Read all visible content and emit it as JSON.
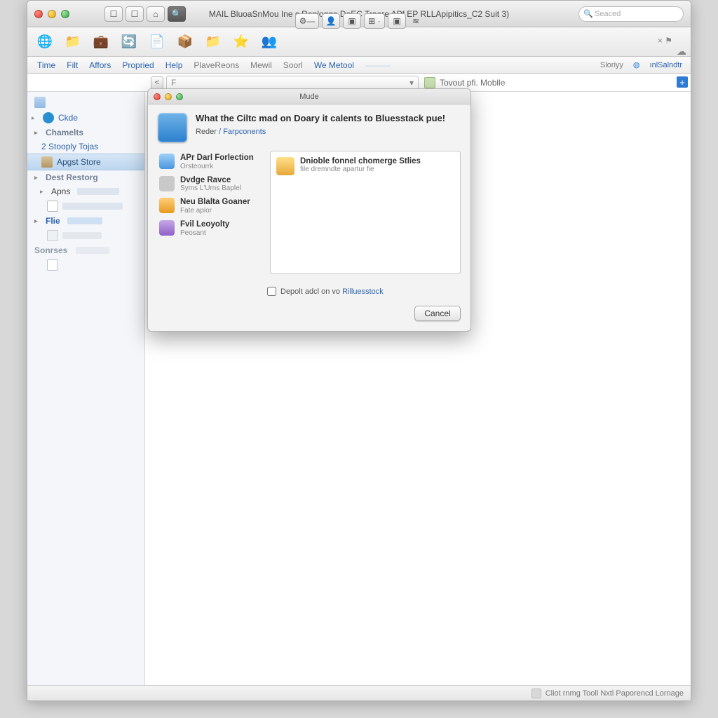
{
  "window": {
    "title": "MAIL BluoaSnMou Ine c Replogge DeEC Traore APf EP RLLApipitics_C2 Suit 3)",
    "search_placeholder": "Seaced"
  },
  "toolbar_center_icons": [
    "⚙—",
    "👤",
    "▣",
    "⊞ ·",
    "▣",
    "≋"
  ],
  "main_toolbar_icons": [
    "globe",
    "folder",
    "briefcase",
    "sync",
    "page",
    "package",
    "folder2",
    "star",
    "people"
  ],
  "menu": {
    "items": [
      "Time",
      "Filt",
      "Affors",
      "Propried",
      "Help",
      "PlaveReons",
      "Mewil",
      "Soorl",
      "We Metool"
    ],
    "extra": "———",
    "right_label_1": "Sloriyy",
    "right_label_2": "ınlSalndtr"
  },
  "pathbar": {
    "back_symbol": "<",
    "input_value": "F",
    "right_text": "Tovout pfi. Moblle"
  },
  "sidebar": {
    "top_icon_row": "",
    "code_btn": "Ckde",
    "channels_head": "Chamelts",
    "stoopy": "2 Stooply Tojas",
    "selected": "Apgst Store",
    "dest_head": "Dest Restorg",
    "apps_item": "Apns",
    "apps_sub_smear": "–––––",
    "file_head": "Flie",
    "file_smear": "–––",
    "file_box_smear": "–––––",
    "sources_head": "Sonrses",
    "sources_smear": "–––––"
  },
  "dialog": {
    "title": "Mude",
    "headline": "What the Ciltc mad on Doary it calents to Bluesstack pue!",
    "sub_prefix": "Reder ",
    "sub_link": "/ Farpconents",
    "left_apps": [
      {
        "title": "APr Darl Forlection",
        "sub": "Orsteourrk",
        "iconClass": "i-blue"
      },
      {
        "title": "Dvdge Ravce",
        "sub": "Syms L'Urns Baplel",
        "iconClass": "i-gray"
      },
      {
        "title": "Neu Blalta Goaner",
        "sub": "Fate apior",
        "iconClass": "i-orange"
      },
      {
        "title": "Fvil Leoyolty",
        "sub": "Peosant",
        "iconClass": "i-purple"
      }
    ],
    "right_item": {
      "title": "Dnioble fonnel chomerge Stlies",
      "sub": "file dremndte apartur fie"
    },
    "checkbox_label": "Depolt adcl on vo ",
    "checkbox_link": "Rilluesstock",
    "cancel": "Cancel"
  },
  "statusbar": {
    "text": "Cliot rnmg Tooll Nxtl Paporencd Lornage"
  }
}
